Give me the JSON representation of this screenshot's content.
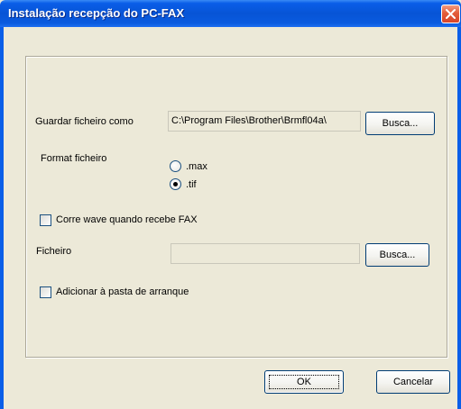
{
  "window": {
    "title": "Instalação recepção do PC-FAX"
  },
  "save_file": {
    "label": "Guardar ficheiro como",
    "path_value": "C:\\Program Files\\Brother\\Brmfl04a\\",
    "browse_label": "Busca..."
  },
  "format": {
    "label": "Format ficheiro",
    "options": [
      {
        "label": ".max",
        "selected": false
      },
      {
        "label": ".tif",
        "selected": true
      }
    ]
  },
  "wave": {
    "checkbox_label": "Corre wave quando recebe FAX",
    "checked": false
  },
  "file": {
    "label": "Ficheiro",
    "value": "",
    "browse_label": "Busca..."
  },
  "startup": {
    "checkbox_label": "Adicionar à pasta de arranque",
    "checked": false
  },
  "buttons": {
    "ok_label": "OK",
    "cancel_label": "Cancelar"
  }
}
